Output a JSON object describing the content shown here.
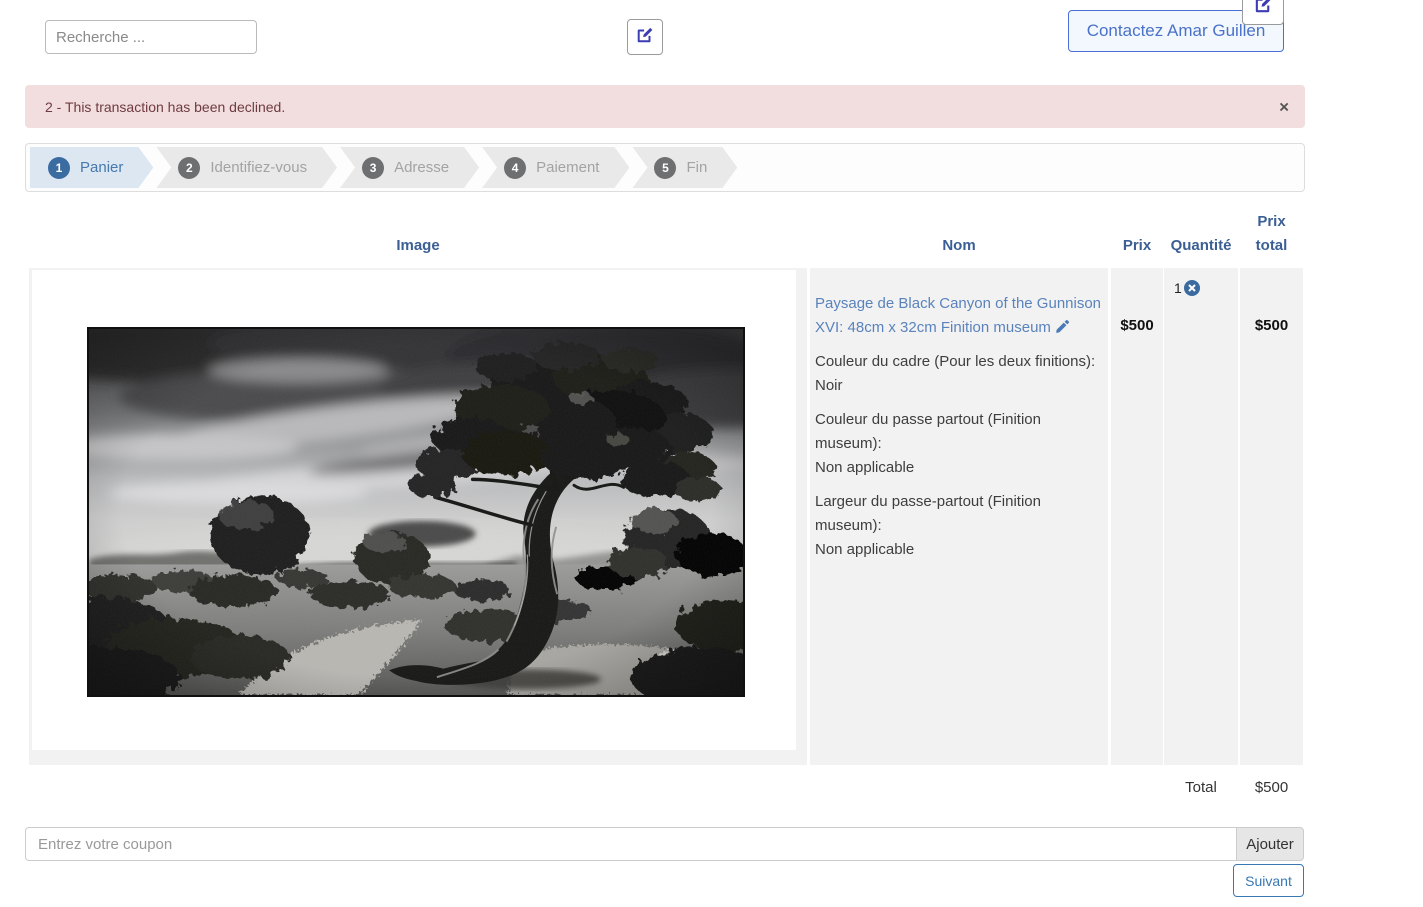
{
  "header": {
    "search_placeholder": "Recherche ...",
    "contact_button_label": "Contactez Amar Guillen"
  },
  "alert": {
    "message": "2 - This transaction has been declined.",
    "close_label": "×"
  },
  "steps": [
    {
      "number": "1",
      "label": "Panier",
      "active": true
    },
    {
      "number": "2",
      "label": "Identifiez-vous",
      "active": false
    },
    {
      "number": "3",
      "label": "Adresse",
      "active": false
    },
    {
      "number": "4",
      "label": "Paiement",
      "active": false
    },
    {
      "number": "5",
      "label": "Fin",
      "active": false
    }
  ],
  "cart_table": {
    "columns": [
      "Image",
      "Nom",
      "Prix",
      "Quantité",
      "Prix total"
    ],
    "rows": [
      {
        "image_alt": "Photo noir et blanc d'un genévrier tordu - Black Canyon of the Gunnison",
        "name_link": "Paysage de Black Canyon of the Gunnison XVI: 48cm x 32cm Finition museum",
        "options": [
          {
            "label": "Couleur du cadre (Pour les deux finitions):",
            "value": "Noir"
          },
          {
            "label": "Couleur du passe partout (Finition museum):",
            "value": "Non applicable"
          },
          {
            "label": "Largeur du passe-partout (Finition museum):",
            "value": "Non applicable"
          }
        ],
        "price": "$500",
        "quantity": "1",
        "total": "$500"
      }
    ],
    "total_label": "Total",
    "total_value": "$500"
  },
  "coupon": {
    "placeholder": "Entrez votre coupon",
    "add_button_label": "Ajouter"
  },
  "next_button_label": "Suivant",
  "icons": {
    "top_buttons": "pen-square-icon",
    "product_name": "pencil-icon",
    "quantity_remove": "circle-x-icon"
  },
  "colors": {
    "step_active_bg": "#dce7f2",
    "step_active_text": "#4679ad",
    "step_circle_active": "#3b6ca1",
    "step_inactive_bg": "#e9e9e9",
    "table_header_text": "#3b5f94",
    "product_link": "#5a83bc",
    "alert_bg": "#f2dede",
    "alert_text": "#6e3b41",
    "edit_icon": "#3c3cb4",
    "contact_border": "#4a6fd4",
    "next_button": "#3878b4"
  }
}
